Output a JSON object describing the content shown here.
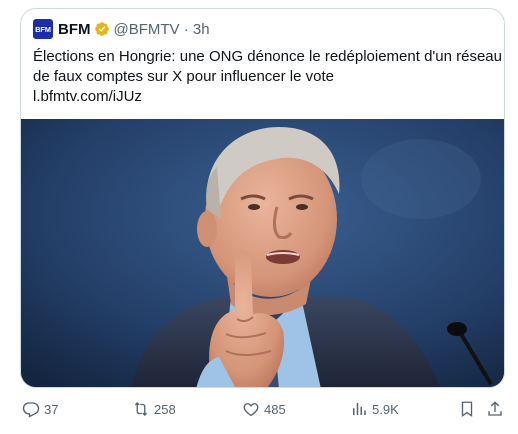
{
  "quote": {
    "avatar_text": "BFM",
    "name": "BFM",
    "handle_time": "@BFMTV · 3h",
    "text_lines": [
      "Élections en Hongrie: une ONG dénonce le redéploiement d'un réseau",
      "de faux comptes sur X pour influencer le vote",
      "l.bfmtv.com/iJUz"
    ],
    "image_alt": "Man speaking with raised index finger"
  },
  "actions": {
    "replies": "37",
    "reposts": "258",
    "likes": "485",
    "views": "5.9K"
  },
  "colors": {
    "text": "#0f1419",
    "muted": "#536471",
    "border": "#cfd9de",
    "verified": "#e2b719",
    "link": "#1d9bf0",
    "avatar_bg": "#1b2ea8"
  },
  "icons": [
    "verified-badge-icon",
    "reply-icon",
    "repost-icon",
    "like-icon",
    "views-icon",
    "bookmark-icon",
    "share-icon"
  ]
}
